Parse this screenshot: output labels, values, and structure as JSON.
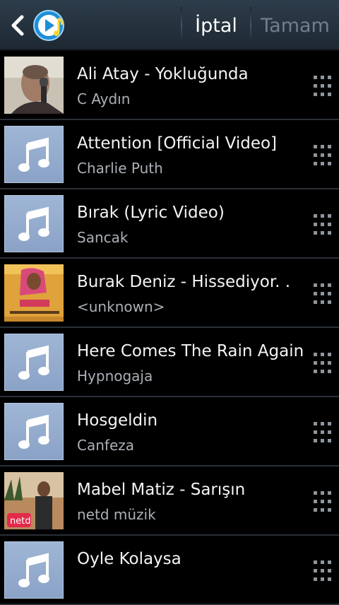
{
  "header": {
    "cancel_label": "İptal",
    "done_label": "Tamam"
  },
  "colors": {
    "header_bg": "#24313d",
    "note_tile": "#93abcf",
    "artist_text": "#aab0b6",
    "done_disabled": "#6f7f8c"
  },
  "songs": [
    {
      "title": "Ali Atay - Yokluğunda",
      "artist": "C Aydın",
      "thumb": "photo"
    },
    {
      "title": "Attention [Official Video]",
      "artist": "Charlie Puth",
      "thumb": "music-note-icon"
    },
    {
      "title": "Bırak (Lyric Video)",
      "artist": "Sancak",
      "thumb": "music-note-icon"
    },
    {
      "title": "Burak Deniz - Hissediyor. .",
      "artist": "<unknown>",
      "thumb": "album-art"
    },
    {
      "title": "Here Comes The Rain Again",
      "artist": "Hypnogaja",
      "thumb": "music-note-icon"
    },
    {
      "title": "Hosgeldin",
      "artist": "Canfeza",
      "thumb": "music-note-icon"
    },
    {
      "title": "Mabel Matiz - Sarışın",
      "artist": "netd müzik",
      "thumb": "photo"
    },
    {
      "title": "Oyle Kolaysa",
      "artist": "",
      "thumb": "music-note-icon"
    }
  ]
}
